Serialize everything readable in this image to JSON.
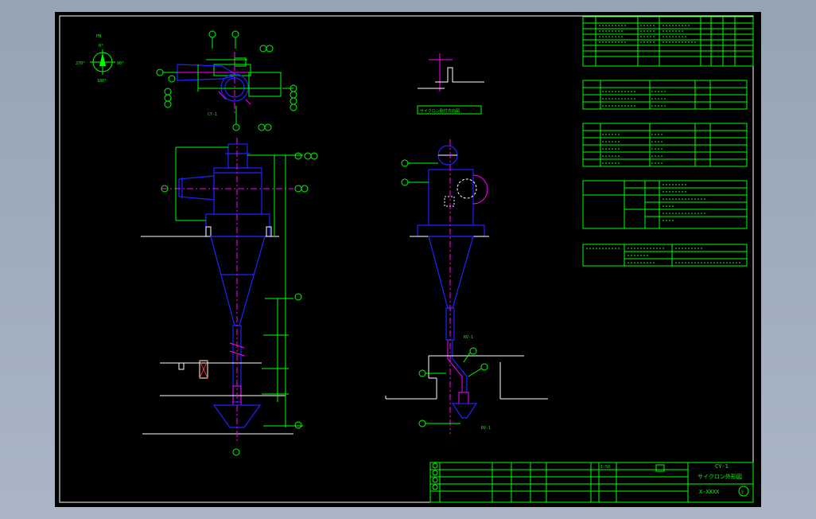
{
  "drawing": {
    "code": "CY-1",
    "title": "サイクロン外形図",
    "drawing_no": "X-XXXX",
    "scale": "1:50",
    "sheet_mark": "①",
    "view_label_top": "CY-1",
    "view_label_detail": "サイクロン取付方向図",
    "valve_label_1": "RV-1",
    "valve_label_2": "RV-1"
  },
  "compass": {
    "north": "0°",
    "west": "270°",
    "east": "90°",
    "south": "180°",
    "mark": "PN"
  },
  "colors": {
    "background": "#000000",
    "frame": "#ffffff",
    "lines": "#00ff00",
    "equipment": "#2222ff",
    "centerline": "#ff00ff"
  }
}
